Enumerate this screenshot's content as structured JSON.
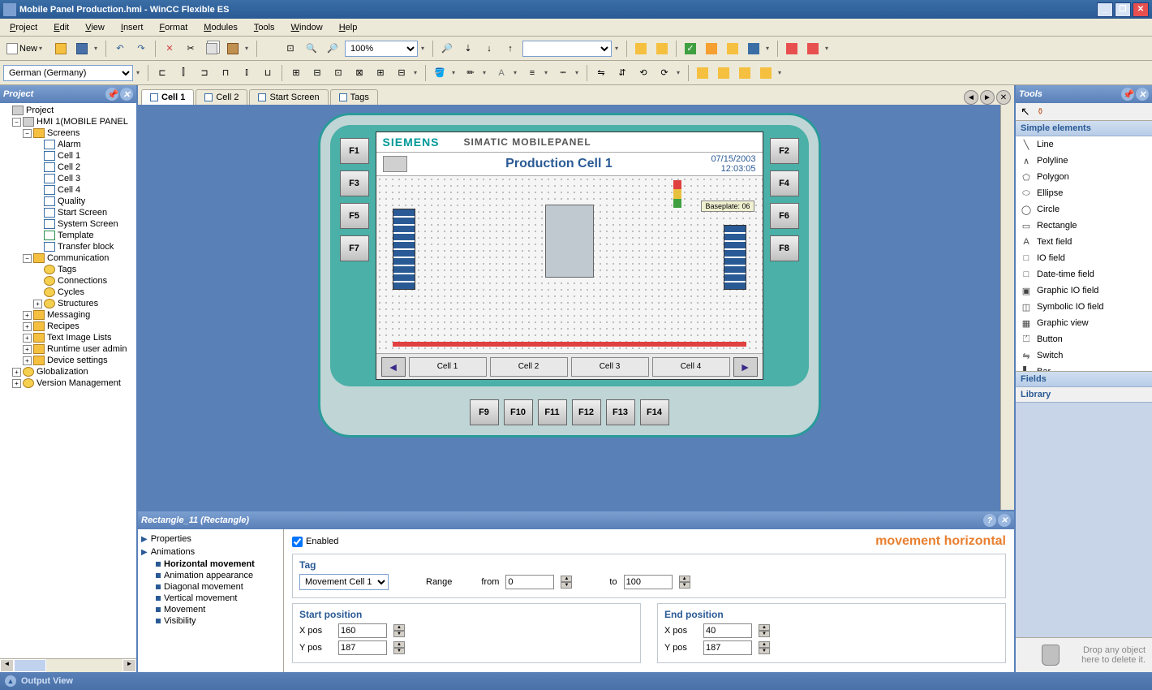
{
  "window": {
    "title": "Mobile Panel Production.hmi - WinCC Flexible ES",
    "minimize": "_",
    "maximize": "❐",
    "close": "✕"
  },
  "menu": [
    "Project",
    "Edit",
    "View",
    "Insert",
    "Format",
    "Modules",
    "Tools",
    "Window",
    "Help"
  ],
  "toolbar": {
    "new_label": "New",
    "zoom": "100%",
    "language": "German (Germany)"
  },
  "project_panel": {
    "title": "Project",
    "tree": {
      "root": "Project",
      "hmi": "HMI 1(MOBILE PANEL",
      "screens": "Screens",
      "screen_items": [
        "Alarm",
        "Cell 1",
        "Cell 2",
        "Cell 3",
        "Cell 4",
        "Quality",
        "Start Screen",
        "System Screen",
        "Template",
        "Transfer block"
      ],
      "communication": "Communication",
      "comm_items": [
        "Tags",
        "Connections",
        "Cycles",
        "Structures"
      ],
      "other": [
        "Messaging",
        "Recipes",
        "Text Image Lists",
        "Runtime user admin",
        "Device settings"
      ],
      "globals": [
        "Globalization",
        "Version Management"
      ]
    }
  },
  "tabs": {
    "items": [
      "Cell 1",
      "Cell 2",
      "Start Screen",
      "Tags"
    ],
    "active": 0
  },
  "device": {
    "brand": "SIEMENS",
    "product": "SIMATIC MOBILEPANEL",
    "screen_title": "Production Cell 1",
    "date": "07/15/2003",
    "time": "12:03:05",
    "baseplate": "Baseplate: 06",
    "left_f": [
      "F1",
      "F3",
      "F5",
      "F7"
    ],
    "right_f": [
      "F2",
      "F4",
      "F6",
      "F8"
    ],
    "bottom_f": [
      "F9",
      "F10",
      "F11",
      "F12",
      "F13",
      "F14"
    ],
    "nav_cells": [
      "Cell 1",
      "Cell 2",
      "Cell 3",
      "Cell 4"
    ]
  },
  "properties": {
    "object": "Rectangle_11 (Rectangle)",
    "cats": [
      "Properties",
      "Animations"
    ],
    "subs": [
      "Horizontal movement",
      "Animation appearance",
      "Diagonal movement",
      "Vertical movement",
      "Movement",
      "Visibility"
    ],
    "title": "movement horizontal",
    "enabled_label": "Enabled",
    "tag_group": "Tag",
    "tag_value": "Movement Cell 1",
    "range_label": "Range",
    "from_label": "from",
    "to_label": "to",
    "from_val": "0",
    "to_val": "100",
    "start_group": "Start position",
    "end_group": "End position",
    "xpos_label": "X pos",
    "ypos_label": "Y pos",
    "start_x": "160",
    "start_y": "187",
    "end_x": "40",
    "end_y": "187"
  },
  "tools": {
    "title": "Tools",
    "section": "Simple elements",
    "items": [
      "Line",
      "Polyline",
      "Polygon",
      "Ellipse",
      "Circle",
      "Rectangle",
      "Text field",
      "IO field",
      "Date-time field",
      "Graphic IO field",
      "Symbolic IO field",
      "Graphic view",
      "Button",
      "Switch",
      "Bar"
    ],
    "fields": "Fields",
    "library": "Library",
    "drop_hint": "Drop any object here to delete it."
  },
  "status": {
    "output_view": "Output View"
  },
  "tool_icons": [
    "╲",
    "∧",
    "⬠",
    "⬭",
    "◯",
    "▭",
    "A",
    "□",
    "□",
    "▣",
    "◫",
    "▦",
    "⏍",
    "⇋",
    "▌"
  ]
}
